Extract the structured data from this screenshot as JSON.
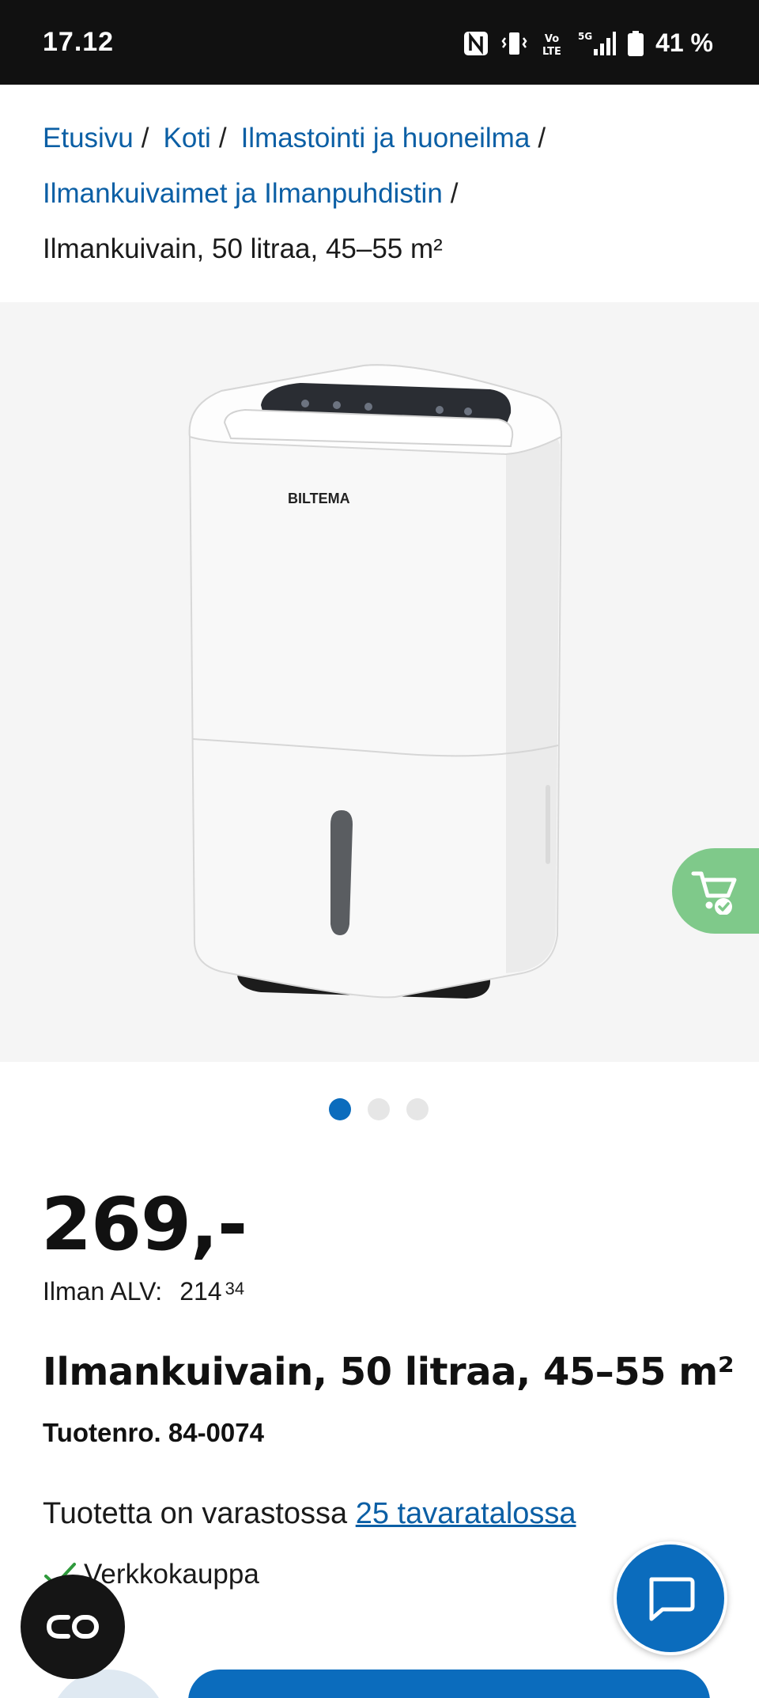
{
  "status_bar": {
    "time": "17.12",
    "battery_percent": "41 %",
    "icons": [
      "nfc-icon",
      "vibrate-icon",
      "volte-icon",
      "5g-signal-icon",
      "battery-icon"
    ]
  },
  "breadcrumb": {
    "links": [
      "Etusivu",
      "Koti",
      "Ilmastointi ja huoneilma",
      "Ilmankuivaimet ja Ilmanpuhdistin"
    ],
    "separator": "/",
    "current": "Ilmankuivain, 50 litraa, 45–55 m²"
  },
  "image": {
    "brand_text": "BILTEMA",
    "carousel_count": 3,
    "active_index": 0
  },
  "price": {
    "main": "269,-",
    "vat_label": "Ilman ALV:",
    "vat_whole": "214",
    "vat_cents": "34"
  },
  "product": {
    "title": "Ilmankuivain, 50 litraa, 45–55 m²",
    "number": "Tuotenro. 84-0074"
  },
  "stock": {
    "text": "Tuotetta on varastossa ",
    "link": "25 tavaratalossa"
  },
  "webshop": {
    "label": "Verkkokauppa"
  },
  "colors": {
    "accent_blue": "#0b6cbd",
    "link_blue": "#0b5fa5",
    "cart_green": "#7fc98a",
    "status_bar": "#111111"
  }
}
